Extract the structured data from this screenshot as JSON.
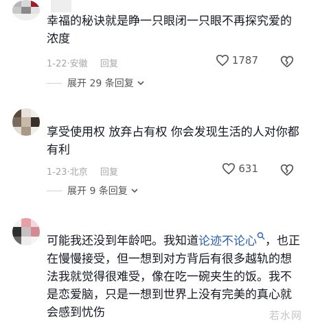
{
  "comments": [
    {
      "text": "幸福的秘诀就是睁一只眼闭一只眼不再探究爱的浓度",
      "date": "1-22",
      "location": "安徽",
      "reply_label": "回复",
      "likes": "1787",
      "expand_label": "展开 29 条回复"
    },
    {
      "text": "享受使用权 放弃占有权 你会发现生活的人对你都有利",
      "date": "1-23",
      "location": "北京",
      "reply_label": "回复",
      "likes": "631",
      "expand_label": "展开 9 条回复"
    },
    {
      "text_pre": "可能我还没到年龄吧。我知道",
      "text_link": "论迹不论心",
      "text_post": "，也正在慢慢接受，但一想到对方背后有很多越轨的想法我就觉得很难受，像在吃一碗夹生的饭。我不是恋爱脑，只是一想到世界上没有完美的真心就会感到忧伤"
    }
  ],
  "watermark": "若水网",
  "icons": [
    "heart-outline-icon",
    "heart-broken-icon",
    "chevron-down-icon",
    "search-icon"
  ],
  "colors": {
    "text": "#161823",
    "meta": "#a5a6ab",
    "link": "#2a5fa8"
  }
}
